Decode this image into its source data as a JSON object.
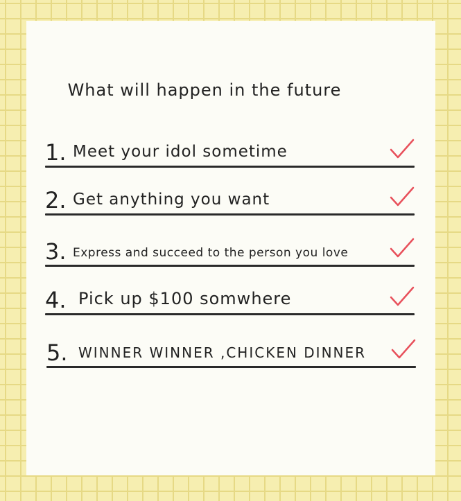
{
  "title": "What will happen in the future",
  "items": [
    {
      "number": "1.",
      "text": "Meet your idol sometime",
      "checked": true
    },
    {
      "number": "2.",
      "text": "Get anything you want",
      "checked": true
    },
    {
      "number": "3.",
      "text": "Express and succeed to the person you love",
      "checked": true
    },
    {
      "number": "4.",
      "text": "Pick up $100 somwhere",
      "checked": true
    },
    {
      "number": "5.",
      "text": "WINNER WINNER ,CHICKEN DINNER",
      "checked": true
    }
  ],
  "colors": {
    "background": "#f6eeb0",
    "grid": "#e6d985",
    "card": "#fcfcf6",
    "ink": "#222222",
    "check": "#e8505b"
  }
}
